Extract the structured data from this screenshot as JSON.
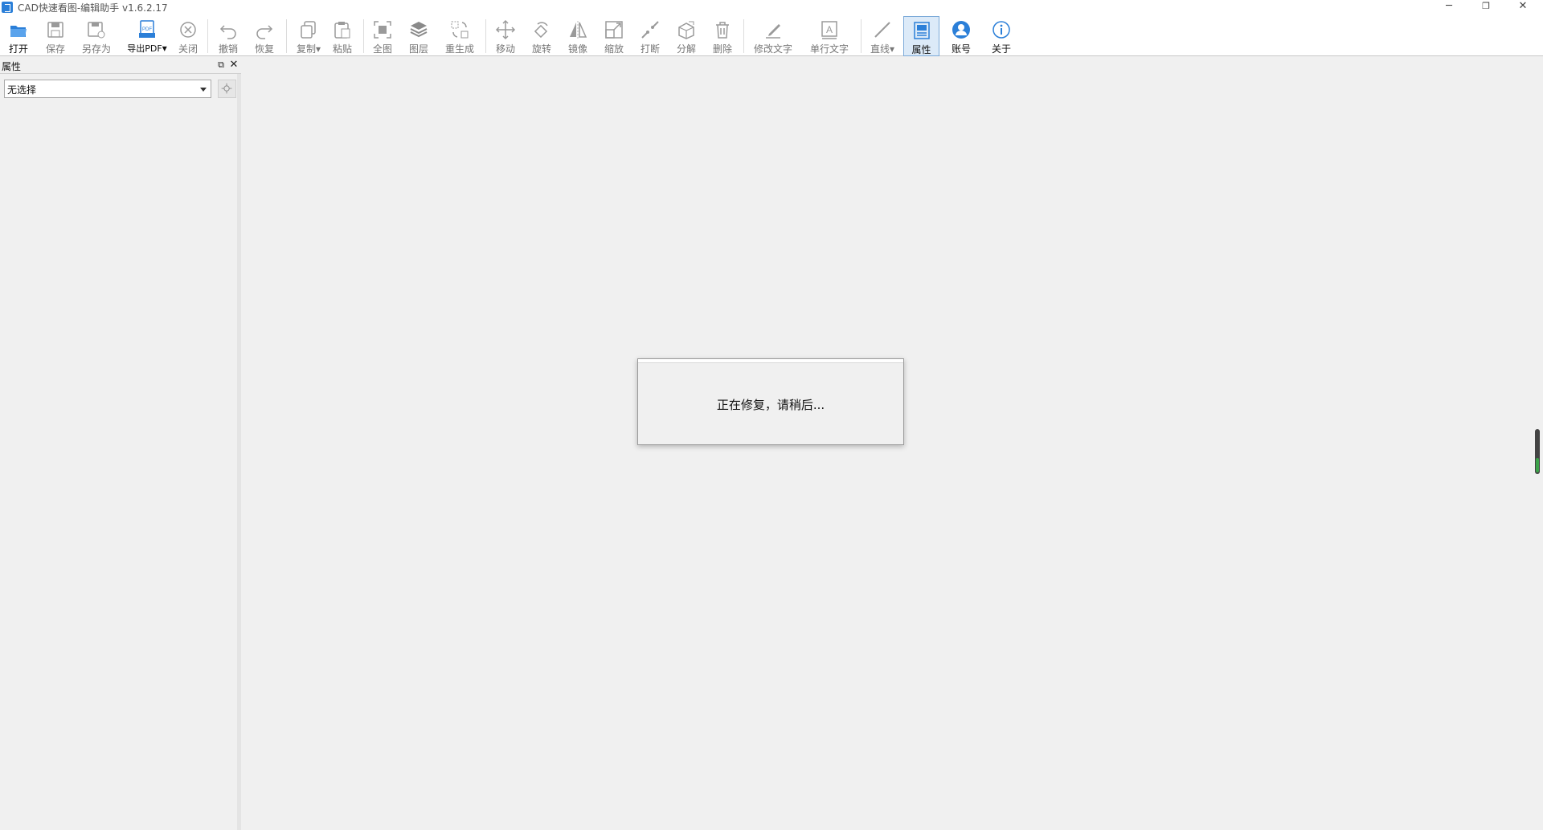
{
  "window": {
    "title": "CAD快速看图-编辑助手 v1.6.2.17",
    "controls": {
      "minimize": "─",
      "restore": "❐",
      "close": "✕"
    }
  },
  "toolbar": {
    "items": [
      {
        "label": "打开",
        "icon": "open-folder-icon"
      },
      {
        "label": "保存",
        "icon": "save-icon"
      },
      {
        "label": "另存为",
        "icon": "save-as-icon"
      },
      {
        "label": "导出PDF",
        "icon": "pdf-export-icon"
      },
      {
        "label": "关闭",
        "icon": "close-circle-icon"
      },
      {
        "label": "撤销",
        "icon": "undo-icon"
      },
      {
        "label": "恢复",
        "icon": "redo-icon"
      },
      {
        "label": "复制",
        "icon": "copy-icon"
      },
      {
        "label": "粘贴",
        "icon": "paste-icon"
      },
      {
        "label": "全图",
        "icon": "fit-view-icon"
      },
      {
        "label": "图层",
        "icon": "layers-icon"
      },
      {
        "label": "重生成",
        "icon": "regenerate-icon"
      },
      {
        "label": "移动",
        "icon": "move-icon"
      },
      {
        "label": "旋转",
        "icon": "rotate-icon"
      },
      {
        "label": "镜像",
        "icon": "mirror-icon"
      },
      {
        "label": "缩放",
        "icon": "scale-icon"
      },
      {
        "label": "打断",
        "icon": "break-icon"
      },
      {
        "label": "分解",
        "icon": "explode-icon"
      },
      {
        "label": "删除",
        "icon": "delete-icon"
      },
      {
        "label": "修改文字",
        "icon": "edit-text-icon"
      },
      {
        "label": "单行文字",
        "icon": "single-line-text-icon"
      },
      {
        "label": "直线",
        "icon": "line-icon"
      },
      {
        "label": "属性",
        "icon": "properties-icon"
      },
      {
        "label": "账号",
        "icon": "account-icon"
      },
      {
        "label": "关于",
        "icon": "about-icon"
      }
    ],
    "dropdown_marker": "▾",
    "accent_color": "#2b7fd8",
    "active_item": "属性"
  },
  "panel": {
    "title": "属性",
    "float_glyph": "⧉",
    "close_glyph": "✕",
    "selection": "无选择"
  },
  "dialog": {
    "message": "正在修复，请稍后..."
  }
}
